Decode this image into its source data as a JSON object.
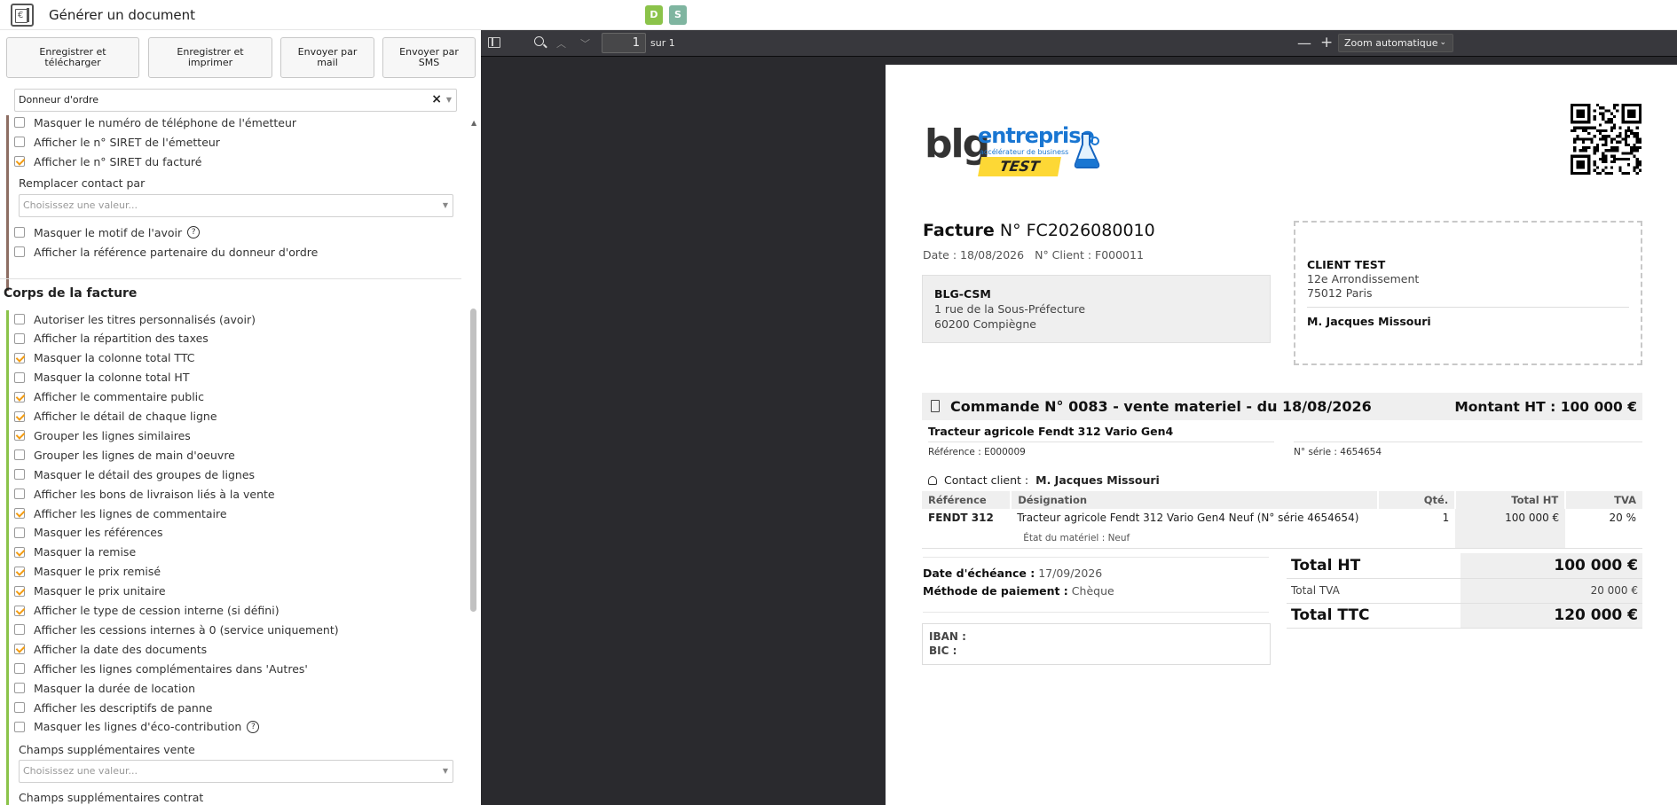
{
  "app": {
    "window_title": "Générer un document",
    "app_icon_symbol": "€",
    "tags": [
      "D",
      "S"
    ],
    "tag_colors": [
      "#8bc34a",
      "#7fb5a0"
    ]
  },
  "actions": {
    "save_download": "Enregistrer et télécharger",
    "save_print": "Enregistrer et imprimer",
    "send_mail": "Envoyer par mail",
    "send_sms": "Envoyer par SMS"
  },
  "options": {
    "donneur_select": "Donneur d'ordre",
    "top_items": [
      {
        "label": "Masquer le numéro de téléphone de l'émetteur",
        "checked": false
      },
      {
        "label": "Afficher le n° SIRET de l'émetteur",
        "checked": false
      },
      {
        "label": "Afficher le n° SIRET du facturé",
        "checked": true
      }
    ],
    "replace_contact_label": "Remplacer contact par",
    "replace_contact_placeholder": "Choisissez une valeur...",
    "mid_items": [
      {
        "label": "Masquer le motif de l'avoir",
        "checked": false,
        "help": true
      },
      {
        "label": "Afficher la référence partenaire du donneur d'ordre",
        "checked": false
      }
    ],
    "body_section_title": "Corps de la facture",
    "body_items": [
      {
        "label": "Autoriser les titres personnalisés (avoir)",
        "checked": false
      },
      {
        "label": "Afficher la répartition des taxes",
        "checked": false
      },
      {
        "label": "Masquer la colonne total TTC",
        "checked": true
      },
      {
        "label": "Masquer la colonne total HT",
        "checked": false
      },
      {
        "label": "Afficher le commentaire public",
        "checked": true
      },
      {
        "label": "Afficher le détail de chaque ligne",
        "checked": true
      },
      {
        "label": "Grouper les lignes similaires",
        "checked": true
      },
      {
        "label": "Grouper les lignes de main d'oeuvre",
        "checked": false
      },
      {
        "label": "Masquer le détail des groupes de lignes",
        "checked": false
      },
      {
        "label": "Afficher les bons de livraison liés à la vente",
        "checked": false
      },
      {
        "label": "Afficher les lignes de commentaire",
        "checked": true
      },
      {
        "label": "Masquer les références",
        "checked": false
      },
      {
        "label": "Masquer la remise",
        "checked": true
      },
      {
        "label": "Masquer le prix remisé",
        "checked": true
      },
      {
        "label": "Masquer le prix unitaire",
        "checked": true
      },
      {
        "label": "Afficher le type de cession interne (si défini)",
        "checked": true
      },
      {
        "label": "Afficher les cessions internes à 0 (service uniquement)",
        "checked": false
      },
      {
        "label": "Afficher la date des documents",
        "checked": true
      },
      {
        "label": "Afficher les lignes complémentaires dans 'Autres'",
        "checked": false
      },
      {
        "label": "Masquer la durée de location",
        "checked": false
      },
      {
        "label": "Afficher les descriptifs de panne",
        "checked": false
      },
      {
        "label": "Masquer les lignes d'éco-contribution",
        "checked": false,
        "help": true
      }
    ],
    "extra_fields_sale_label": "Champs supplémentaires vente",
    "extra_fields_sale_placeholder": "Choisissez une valeur...",
    "extra_fields_contract_label": "Champs supplémentaires contrat",
    "help_glyph": "?"
  },
  "viewer": {
    "page_number": "1",
    "page_total": "sur 1",
    "zoom": "Zoom automatique"
  },
  "invoice": {
    "logo": {
      "blg": "blg",
      "entreprise": "entreprise",
      "tagline": "accélérateur de business",
      "test": "TEST"
    },
    "title_word": "Facture",
    "number": "N° FC2026080010",
    "date": "Date : 18/08/2026",
    "client_number": "N° Client : F000011",
    "issuer": {
      "name": "BLG-CSM",
      "address1": "1 rue de la Sous-Préfecture",
      "address2": "60200 Compiègne"
    },
    "client": {
      "name": "CLIENT TEST",
      "address1": "12e Arrondissement",
      "address2": "75012 Paris",
      "contact": "M. Jacques Missouri"
    },
    "order_title": "Commande N° 0083 - vente materiel - du 18/08/2026",
    "order_amount": "Montant HT : 100 000 €",
    "product_name": "Tracteur agricole Fendt 312 Vario Gen4",
    "product_ref": "Référence : E000009",
    "product_serial": "N° série : 4654654",
    "contact_label": "Contact client :",
    "contact_name": "M. Jacques Missouri",
    "table_headers": {
      "ref": "Référence",
      "designation": "Désignation",
      "qty": "Qté.",
      "total_ht": "Total HT",
      "tva": "TVA"
    },
    "line": {
      "ref": "FENDT 312",
      "designation": "Tracteur agricole Fendt 312 Vario Gen4 Neuf (N° série 4654654)",
      "qty": "1",
      "total_ht": "100 000 €",
      "tva": "20 %"
    },
    "line_detail": "État du matériel : Neuf",
    "due_label": "Date d'échéance :",
    "due_value": "17/09/2026",
    "payment_label": "Méthode de paiement :",
    "payment_value": "Chèque",
    "iban_label": "IBAN :",
    "bic_label": "BIC :",
    "totals": {
      "ht_label": "Total HT",
      "ht_value": "100 000 €",
      "tva_label": "Total TVA",
      "tva_value": "20 000 €",
      "ttc_label": "Total TTC",
      "ttc_value": "120 000 €"
    }
  },
  "colors": {
    "accent_check": "#f39c12",
    "section_top": "#8d6e63",
    "section_body": "#8bc34a",
    "viewer_bg": "#2a2a2e",
    "brand_blue": "#1976d2",
    "brand_yellow": "#fdd835"
  }
}
